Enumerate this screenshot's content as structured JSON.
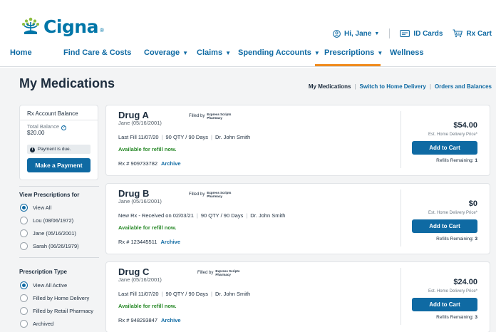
{
  "header": {
    "brand": "Cigna",
    "brand_mark": "®",
    "greeting": "Hi, Jane",
    "id_cards": "ID Cards",
    "rx_cart": "Rx Cart"
  },
  "nav": {
    "items": [
      {
        "label": "Home",
        "dropdown": false
      },
      {
        "label": "Find Care & Costs",
        "dropdown": false
      },
      {
        "label": "Coverage",
        "dropdown": true
      },
      {
        "label": "Claims",
        "dropdown": true
      },
      {
        "label": "Spending Accounts",
        "dropdown": true
      },
      {
        "label": "Prescriptions",
        "dropdown": true,
        "active": true
      },
      {
        "label": "Wellness",
        "dropdown": false
      }
    ],
    "active_color": "#f08a1c"
  },
  "page": {
    "title": "My Medications",
    "links": {
      "current": "My Medications",
      "home_delivery": "Switch to Home Delivery",
      "orders": "Orders and Balances"
    }
  },
  "account": {
    "title": "Rx Account Balance",
    "total_label": "Total Balance",
    "total_value": "$20.00",
    "due_notice": "Payment is due.",
    "pay_button": "Make a Payment"
  },
  "filters": {
    "view_for": {
      "title": "View Prescriptions for",
      "options": [
        "View All",
        "Lou (08/06/1972)",
        "Jane (05/16/2001)",
        "Sarah (06/26/1979)"
      ],
      "selected": "View All"
    },
    "type": {
      "title": "Prescription Type",
      "options": [
        "View All Active",
        "Filled by Home Delivery",
        "Filled by Retail Pharmacy",
        "Archived"
      ],
      "selected": "View All Active"
    }
  },
  "medications": [
    {
      "name": "Drug A",
      "filled_by": "Filled by",
      "pharmacy": [
        "Express Scripts",
        "Pharmacy"
      ],
      "patient": "Jane (05/16/2001)",
      "fill_info": "Last Fill 11/07/20",
      "qty": "90 QTY / 90 Days",
      "doctor": "Dr. John Smith",
      "status": "Available for refill now.",
      "rx_number": "Rx # 909733782",
      "archive": "Archive",
      "price": "$54.00",
      "price_label": "Est. Home Delivery Price*",
      "cart_button": "Add to Cart",
      "refills_label": "Refills Remaining:",
      "refills": "1"
    },
    {
      "name": "Drug B",
      "filled_by": "Filled by",
      "pharmacy": [
        "Express Scripts",
        "Pharmacy"
      ],
      "patient": "Jane (05/16/2001)",
      "fill_info": "New Rx - Received on 02/03/21",
      "qty": "90 QTY / 90 Days",
      "doctor": "Dr. John Smith",
      "status": "Available for refill now.",
      "rx_number": "Rx # 123445511",
      "archive": "Archive",
      "price": "$0",
      "price_label": "Est. Home Delivery Price*",
      "cart_button": "Add to Cart",
      "refills_label": "Refills Remaining:",
      "refills": "3"
    },
    {
      "name": "Drug C",
      "filled_by": "Filled by",
      "pharmacy": [
        "Express Scripts",
        "Pharmacy"
      ],
      "patient": "Jane (05/16/2001)",
      "fill_info": "Last Fill 11/07/20",
      "qty": "90 QTY / 90 Days",
      "doctor": "Dr. John Smith",
      "status": "Available for refill now.",
      "rx_number": "Rx # 948293847",
      "archive": "Archive",
      "price": "$24.00",
      "price_label": "Est. Home Delivery Price*",
      "cart_button": "Add to Cart",
      "refills_label": "Refills Remaining:",
      "refills": "3"
    }
  ],
  "colors": {
    "brand_blue": "#0076a8",
    "link_blue": "#0f6aa3",
    "available_green": "#2a8a2a",
    "tree_green": "#8cbd3f",
    "nav_active": "#f08a1c"
  }
}
